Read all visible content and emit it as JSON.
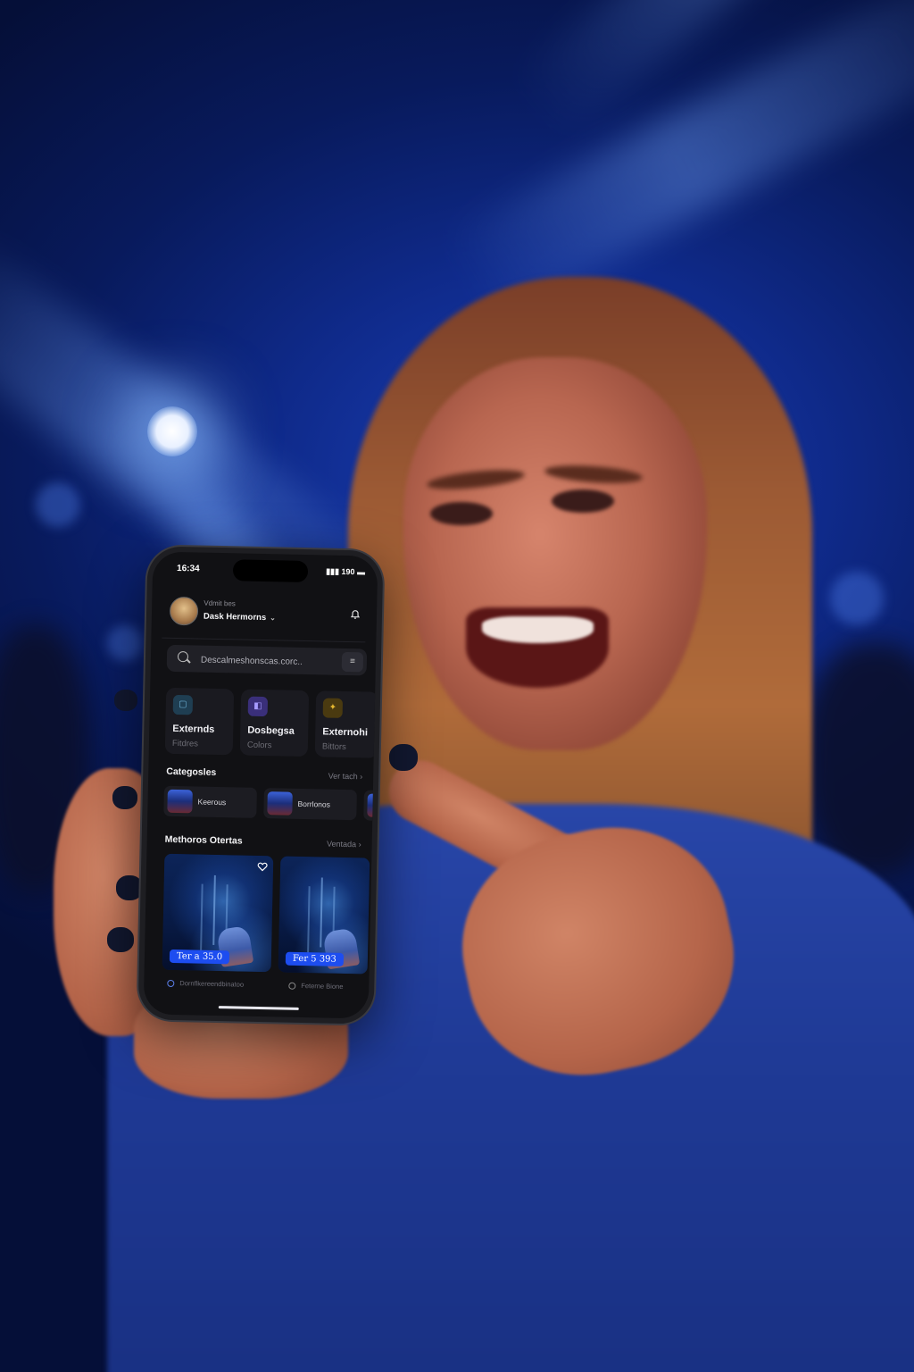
{
  "status_bar": {
    "time": "16:34",
    "network": "190"
  },
  "header": {
    "greeting": "Vdmit bes",
    "user_name": "Dask Hermorns"
  },
  "search": {
    "placeholder": "Descalmeshonscas.corc.."
  },
  "quick_cards": [
    {
      "title": "Externds",
      "subtitle": "Fitdres",
      "icon": "folder-icon",
      "accent": "#1f3e52"
    },
    {
      "title": "Dosbegsa",
      "subtitle": "Colors",
      "icon": "copy-icon",
      "accent": "#3a2f7a"
    },
    {
      "title": "Externohi",
      "subtitle": "Bittors",
      "icon": "badge-icon",
      "accent": "#4a3a10"
    }
  ],
  "categories": {
    "title": "Categosles",
    "link": "Ver tach",
    "items": [
      {
        "label": "Keerous"
      },
      {
        "label": "Borrlonos"
      }
    ]
  },
  "offers": {
    "title": "Methoros Otertas",
    "link": "Ventada",
    "items": [
      {
        "price": "Ter a 35.0",
        "caption": "Dornflkereendbinatoo"
      },
      {
        "price": "Fer 5 393",
        "caption": "Feterne Bione"
      }
    ]
  },
  "colors": {
    "price_badge": "#1d4df0",
    "screen_bg": "#111114"
  }
}
